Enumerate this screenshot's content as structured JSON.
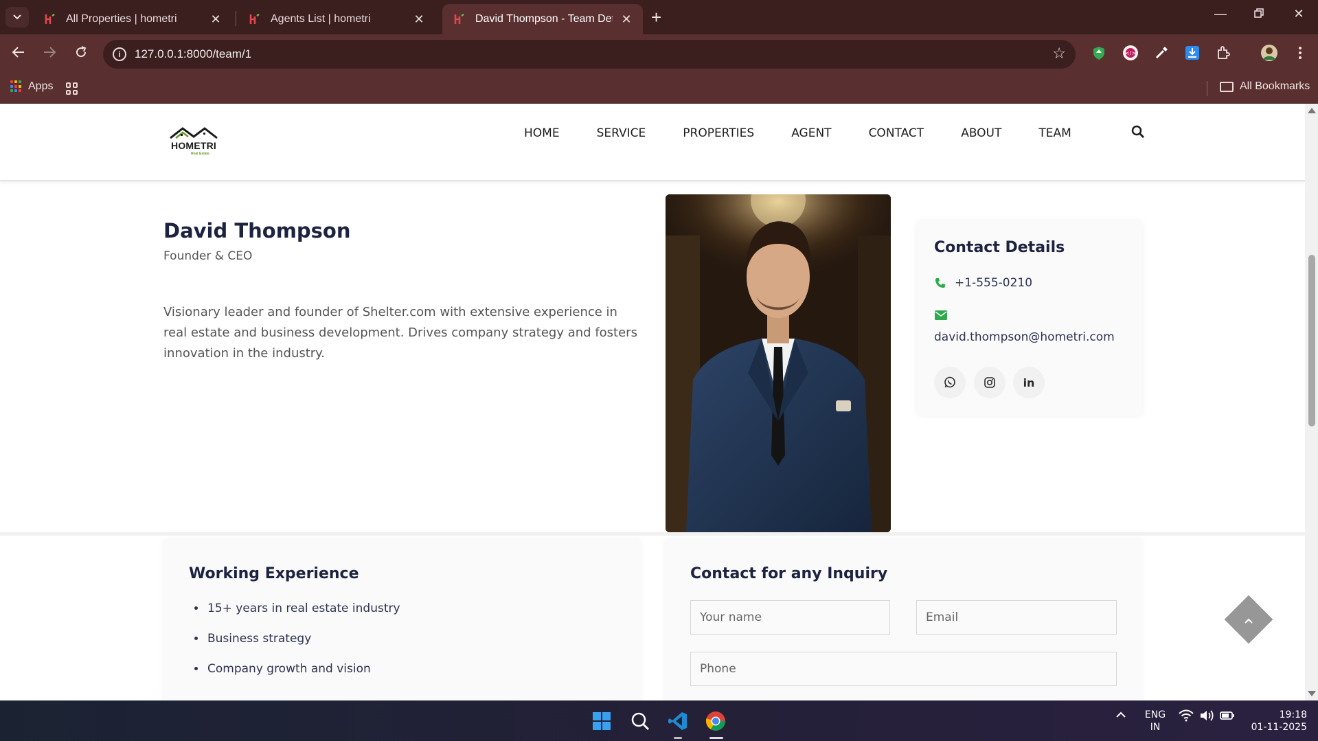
{
  "browser": {
    "tabs": [
      {
        "title": "All Properties | hometri",
        "active": false
      },
      {
        "title": "Agents List | hometri",
        "active": false
      },
      {
        "title": "David Thompson - Team Details",
        "active": true
      }
    ],
    "url": "127.0.0.1:8000/team/1",
    "bookmarks": {
      "apps_label": "Apps",
      "all_bookmarks_label": "All Bookmarks"
    },
    "theme_color": "#5a2f2f"
  },
  "site": {
    "logo_text": "HOMETRI",
    "logo_subtext": "Real Estate",
    "nav": [
      "HOME",
      "SERVICE",
      "PROPERTIES",
      "AGENT",
      "CONTACT",
      "ABOUT",
      "TEAM"
    ],
    "accent_color": "#2eaa4a"
  },
  "profile": {
    "name": "David Thompson",
    "role": "Founder & CEO",
    "bio": "Visionary leader and founder of Shelter.com with extensive experience in real estate and business development. Drives company strategy and fosters innovation in the industry."
  },
  "contact_details": {
    "title": "Contact Details",
    "phone": "+1-555-0210",
    "email": "david.thompson@hometri.com",
    "social": [
      "whatsapp-icon",
      "instagram-icon",
      "linkedin-icon"
    ]
  },
  "experience": {
    "title": "Working Experience",
    "items": [
      "15+ years in real estate industry",
      "Business strategy",
      "Company growth and vision"
    ]
  },
  "inquiry": {
    "title": "Contact for any Inquiry",
    "name_placeholder": "Your name",
    "email_placeholder": "Email",
    "phone_placeholder": "Phone"
  },
  "taskbar": {
    "lang_line1": "ENG",
    "lang_line2": "IN",
    "time": "19:18",
    "date": "01-11-2025"
  }
}
